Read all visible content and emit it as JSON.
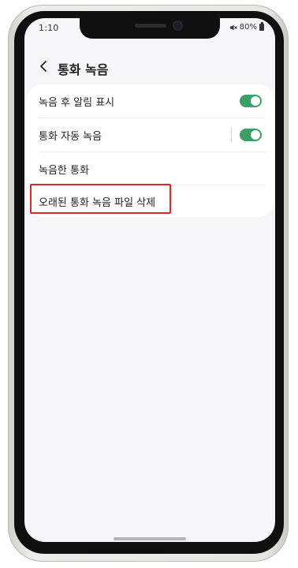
{
  "status_bar": {
    "time": "1:10",
    "battery": "80%",
    "icons": [
      "mute-icon",
      "battery-icon"
    ]
  },
  "header": {
    "back_icon": "chevron-left-icon",
    "title": "통화 녹음"
  },
  "settings": {
    "items": [
      {
        "label": "녹음 후 알림 표시",
        "toggle": true
      },
      {
        "label": "통화 자동 녹음",
        "toggle": true
      },
      {
        "label": "녹음한 통화"
      },
      {
        "label": "오래된 통화 녹음 파일 삭제",
        "highlighted": true
      }
    ]
  },
  "colors": {
    "toggle_on": "#3aa066",
    "highlight": "#e0262e",
    "screen_bg": "#f6f6f8"
  }
}
